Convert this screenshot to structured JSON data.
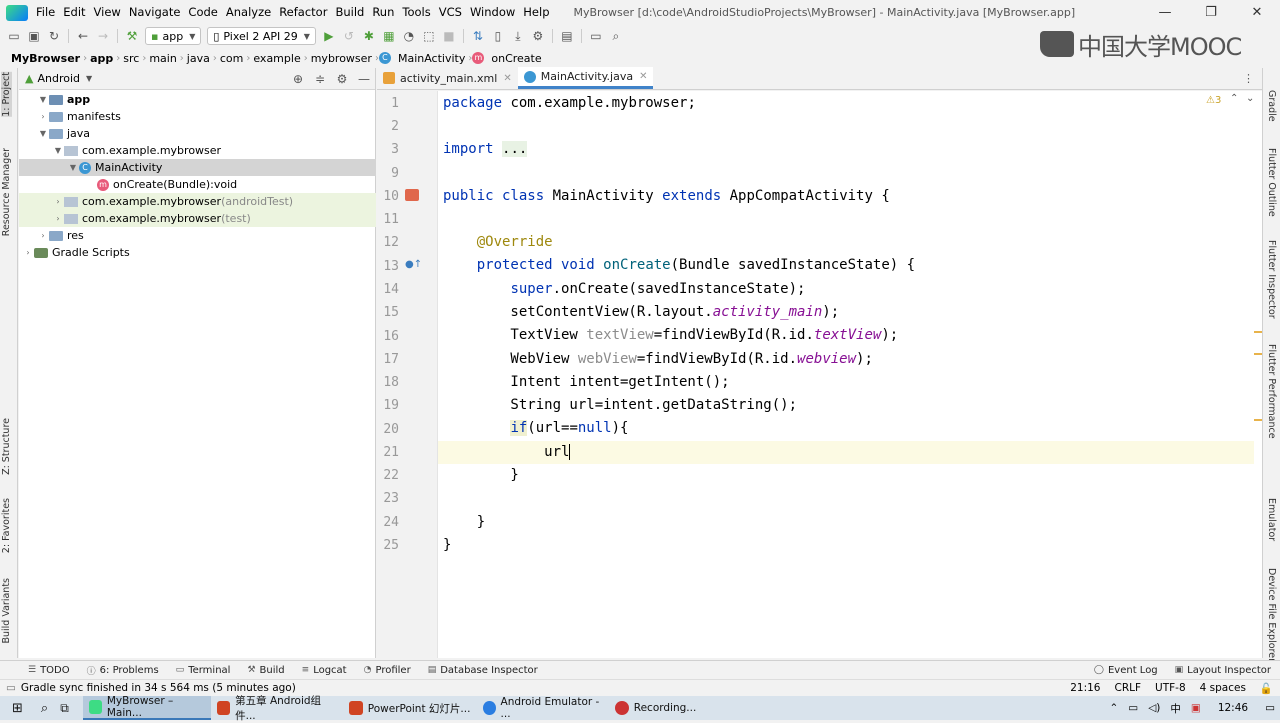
{
  "menubar": {
    "items": [
      "File",
      "Edit",
      "View",
      "Navigate",
      "Code",
      "Analyze",
      "Refactor",
      "Build",
      "Run",
      "Tools",
      "VCS",
      "Window",
      "Help"
    ],
    "window_title": "MyBrowser [d:\\code\\AndroidStudioProjects\\MyBrowser] - MainActivity.java [MyBrowser.app]"
  },
  "toolbar": {
    "run_config": "app",
    "device": "Pixel 2 API 29"
  },
  "watermark": "中国大学MOOC",
  "breadcrumb": [
    "MyBrowser",
    "app",
    "src",
    "main",
    "java",
    "com",
    "example",
    "mybrowser",
    "MainActivity",
    "onCreate"
  ],
  "side_left": [
    "1: Project",
    "Resource Manager",
    "Z: Structure",
    "2: Favorites",
    "Build Variants"
  ],
  "side_right": [
    "Gradle",
    "Flutter Outline",
    "Flutter Inspector",
    "Flutter Performance",
    "Emulator",
    "Device File Explorer"
  ],
  "project": {
    "view_mode": "Android",
    "tree": [
      {
        "label": "app",
        "suffix": ""
      },
      {
        "label": "manifests",
        "suffix": ""
      },
      {
        "label": "java",
        "suffix": ""
      },
      {
        "label": "com.example.mybrowser",
        "suffix": ""
      },
      {
        "label": "MainActivity",
        "suffix": ""
      },
      {
        "label": "onCreate(Bundle):void",
        "suffix": ""
      },
      {
        "label": "com.example.mybrowser",
        "suffix": " (androidTest)"
      },
      {
        "label": "com.example.mybrowser",
        "suffix": " (test)"
      },
      {
        "label": "res",
        "suffix": ""
      },
      {
        "label": "Gradle Scripts",
        "suffix": ""
      }
    ]
  },
  "editor": {
    "tabs": [
      "activity_main.xml",
      "MainActivity.java"
    ],
    "warnings": "3",
    "line_numbers": [
      "1",
      "2",
      "3",
      "9",
      "10",
      "11",
      "12",
      "13",
      "14",
      "15",
      "16",
      "17",
      "18",
      "19",
      "20",
      "21",
      "22",
      "23",
      "24",
      "25"
    ]
  },
  "bottom_tools": [
    "TODO",
    "6: Problems",
    "Terminal",
    "Build",
    "Logcat",
    "Profiler",
    "Database Inspector"
  ],
  "bottom_right_tools": [
    "Event Log",
    "Layout Inspector"
  ],
  "status": {
    "message": "Gradle sync finished in 34 s 564 ms (5 minutes ago)",
    "position": "21:16",
    "line_sep": "CRLF",
    "encoding": "UTF-8",
    "indent": "4 spaces"
  },
  "taskbar": {
    "apps": [
      "MyBrowser – Main...",
      "第五章 Android组件...",
      "PowerPoint 幻灯片...",
      "Android Emulator - ...",
      "Recording..."
    ],
    "ime": "中",
    "time": "12:46"
  }
}
